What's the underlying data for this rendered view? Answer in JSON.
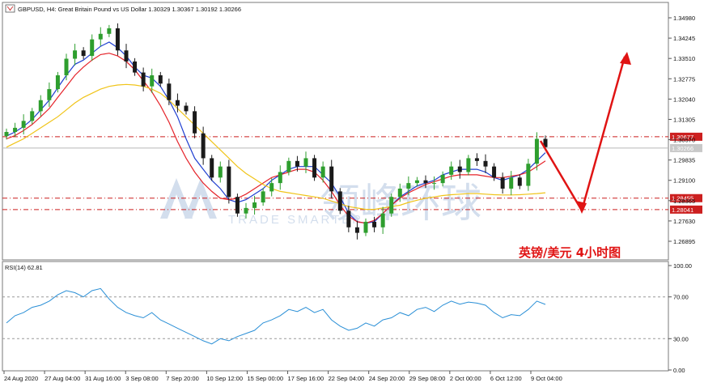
{
  "header": {
    "symbol_info": "GBPUSD, H4:  Great Britain Pound vs US Dollar  1.30329 1.30367 1.30192 1.30266"
  },
  "watermark": {
    "brand_cn": "领峰环球",
    "slogan": "TRADE SMARTER"
  },
  "annotation": {
    "title": "英镑/美元  4小时图"
  },
  "colors": {
    "bull": "#2e9e2e",
    "bear": "#1a1a1a",
    "ma_fast": "#1f3fd1",
    "ma_mid": "#e5232a",
    "ma_slow": "#f0c419",
    "level_line": "#cc1f1f",
    "rsi_line": "#2a8fd6",
    "arrow": "#e01414"
  },
  "chart_data": [
    {
      "type": "candlestick",
      "title": "GBPUSD, H4",
      "y_ticks": [
        "1.34980",
        "1.34245",
        "1.33510",
        "1.32775",
        "1.32040",
        "1.31305",
        "1.30570",
        "1.29835",
        "1.29100",
        "1.28365",
        "1.27630",
        "1.26895"
      ],
      "x_ticks": [
        "24 Aug 2020",
        "27 Aug 04:00",
        "31 Aug 16:00",
        "3 Sep 08:00",
        "7 Sep 20:00",
        "10 Sep 12:00",
        "15 Sep 00:00",
        "17 Sep 16:00",
        "22 Sep 04:00",
        "24 Sep 20:00",
        "29 Sep 08:00",
        "2 Oct 00:00",
        "6 Oct 12:00",
        "9 Oct 04:00"
      ],
      "ylim": [
        1.2645,
        1.3515
      ],
      "price_labels": [
        {
          "value": 1.30677,
          "text": "1.30677",
          "style": "resistance"
        },
        {
          "value": 1.30266,
          "text": "1.30266",
          "style": "current"
        },
        {
          "value": 1.28455,
          "text": "1.28455",
          "style": "support"
        },
        {
          "value": 1.28041,
          "text": "1.28041",
          "style": "support"
        }
      ],
      "series": [
        {
          "name": "Close",
          "values": [
            1.3085,
            1.31,
            1.3125,
            1.316,
            1.32,
            1.324,
            1.329,
            1.335,
            1.338,
            1.336,
            1.342,
            1.344,
            1.346,
            1.338,
            1.334,
            1.33,
            1.325,
            1.329,
            1.326,
            1.32,
            1.318,
            1.316,
            1.308,
            1.299,
            1.292,
            1.296,
            1.285,
            1.279,
            1.281,
            1.283,
            1.287,
            1.29,
            1.294,
            1.298,
            1.296,
            1.299,
            1.292,
            1.296,
            1.287,
            1.28,
            1.274,
            1.272,
            1.276,
            1.274,
            1.279,
            1.285,
            1.288,
            1.29,
            1.291,
            1.29,
            1.29,
            1.293,
            1.296,
            1.294,
            1.299,
            1.298,
            1.296,
            1.292,
            1.288,
            1.292,
            1.289,
            1.297,
            1.306,
            1.303
          ]
        }
      ],
      "moving_averages": [
        {
          "name": "MA fast",
          "values": [
            1.307,
            1.3085,
            1.3105,
            1.313,
            1.3165,
            1.32,
            1.3245,
            1.329,
            1.333,
            1.3345,
            1.337,
            1.3395,
            1.341,
            1.339,
            1.336,
            1.332,
            1.329,
            1.328,
            1.325,
            1.32,
            1.314,
            1.306,
            1.299,
            1.295,
            1.291,
            1.288,
            1.284,
            1.283,
            1.284,
            1.286,
            1.288,
            1.291,
            1.293,
            1.295,
            1.296,
            1.296,
            1.296,
            1.293,
            1.29,
            1.285,
            1.279,
            1.276,
            1.2755,
            1.276,
            1.279,
            1.282,
            1.285,
            1.287,
            1.289,
            1.29,
            1.291,
            1.293,
            1.294,
            1.295,
            1.295,
            1.295,
            1.294,
            1.292,
            1.291,
            1.292,
            1.293,
            1.295,
            1.298,
            1.301
          ]
        },
        {
          "name": "MA mid",
          "values": [
            1.306,
            1.3072,
            1.309,
            1.3112,
            1.314,
            1.317,
            1.321,
            1.325,
            1.329,
            1.332,
            1.3345,
            1.3365,
            1.337,
            1.336,
            1.334,
            1.331,
            1.327,
            1.323,
            1.318,
            1.312,
            1.305,
            1.299,
            1.294,
            1.29,
            1.287,
            1.2845,
            1.284,
            1.2845,
            1.286,
            1.288,
            1.29,
            1.292,
            1.293,
            1.294,
            1.295,
            1.295,
            1.294,
            1.291,
            1.287,
            1.282,
            1.278,
            1.276,
            1.2755,
            1.2765,
            1.279,
            1.282,
            1.2845,
            1.2865,
            1.288,
            1.2895,
            1.2905,
            1.2915,
            1.2925,
            1.293,
            1.293,
            1.293,
            1.2925,
            1.292,
            1.292,
            1.2925,
            1.293,
            1.294,
            1.296,
            1.298
          ]
        },
        {
          "name": "MA slow",
          "values": [
            1.303,
            1.3045,
            1.306,
            1.308,
            1.31,
            1.312,
            1.314,
            1.3165,
            1.319,
            1.321,
            1.3225,
            1.324,
            1.325,
            1.3255,
            1.3257,
            1.3255,
            1.325,
            1.324,
            1.3225,
            1.32,
            1.317,
            1.314,
            1.311,
            1.308,
            1.305,
            1.302,
            1.299,
            1.296,
            1.2935,
            1.2915,
            1.2895,
            1.288,
            1.287,
            1.2865,
            1.286,
            1.2855,
            1.285,
            1.2845,
            1.2835,
            1.2825,
            1.2815,
            1.281,
            1.2805,
            1.2805,
            1.281,
            1.2815,
            1.282,
            1.283,
            1.2838,
            1.2845,
            1.285,
            1.2855,
            1.2858,
            1.286,
            1.2862,
            1.2862,
            1.286,
            1.2858,
            1.2857,
            1.2857,
            1.2858,
            1.286,
            1.2862,
            1.2865
          ]
        }
      ]
    },
    {
      "type": "line",
      "title": "RSI(14) 62.81",
      "y_ticks": [
        "100.00",
        "70.00",
        "30.00",
        "0.00"
      ],
      "ylim": [
        0,
        100
      ],
      "levels": [
        70,
        30
      ],
      "series": [
        {
          "name": "RSI(14)",
          "values": [
            45,
            52,
            55,
            60,
            62,
            66,
            72,
            76,
            74,
            70,
            76,
            78,
            68,
            60,
            55,
            52,
            50,
            55,
            48,
            44,
            40,
            36,
            32,
            28,
            25,
            30,
            28,
            32,
            35,
            38,
            45,
            48,
            52,
            58,
            56,
            60,
            55,
            58,
            48,
            42,
            38,
            40,
            45,
            42,
            48,
            50,
            55,
            52,
            58,
            60,
            56,
            62,
            66,
            63,
            65,
            64,
            62,
            55,
            50,
            53,
            52,
            58,
            66,
            62.81
          ]
        }
      ]
    }
  ]
}
